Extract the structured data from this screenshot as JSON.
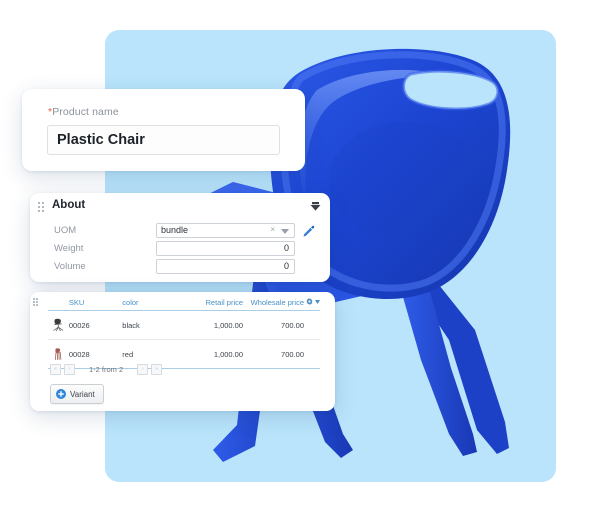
{
  "theme": {
    "backdrop_color": "#b9e4fb",
    "chair_color": "#1b47d8",
    "accent_blue": "#4a90c4",
    "required_star_color": "#e8603c",
    "card_bg": "#ffffff"
  },
  "product_card": {
    "label_required_marker": "*",
    "label": "Product name",
    "value": "Plastic Chair",
    "placeholder": "Product name"
  },
  "about_panel": {
    "title": "About",
    "drag_handle_icon": "drag-dots-icon",
    "collapse_icon": "chevron-down-icon",
    "rows": [
      {
        "label": "UOM",
        "value": "bundle",
        "type": "select",
        "clear_icon": "×",
        "caret_icon": "chevron-down-icon",
        "edit_icon": "pencil-icon"
      },
      {
        "label": "Weight",
        "value": "0",
        "type": "number"
      },
      {
        "label": "Volume",
        "value": "0",
        "type": "number"
      }
    ]
  },
  "variants_table": {
    "drag_handle_icon": "drag-dots-icon",
    "columns": [
      "",
      "SKU",
      "color",
      "Retail price",
      "Wholesale price"
    ],
    "settings_icon": "gear-icon",
    "settings_caret_icon": "chevron-down-icon",
    "rows": [
      {
        "thumbnail": "chair-black-thumb",
        "thumbnail_color": "#3b3b3b",
        "sku": "00026",
        "color": "black",
        "retail_price": "1,000.00",
        "wholesale_price": "700.00"
      },
      {
        "thumbnail": "chair-red-thumb",
        "thumbnail_color": "#a85b52",
        "sku": "00028",
        "color": "red",
        "retail_price": "1,000.00",
        "wholesale_price": "700.00"
      }
    ],
    "pagination": {
      "first_icon": "«",
      "prev_icon": "‹",
      "label": "1-2 from 2",
      "next_icon": "›",
      "last_icon": "»"
    },
    "add_button": {
      "icon": "plus-circle-icon",
      "label": "Variant"
    }
  }
}
